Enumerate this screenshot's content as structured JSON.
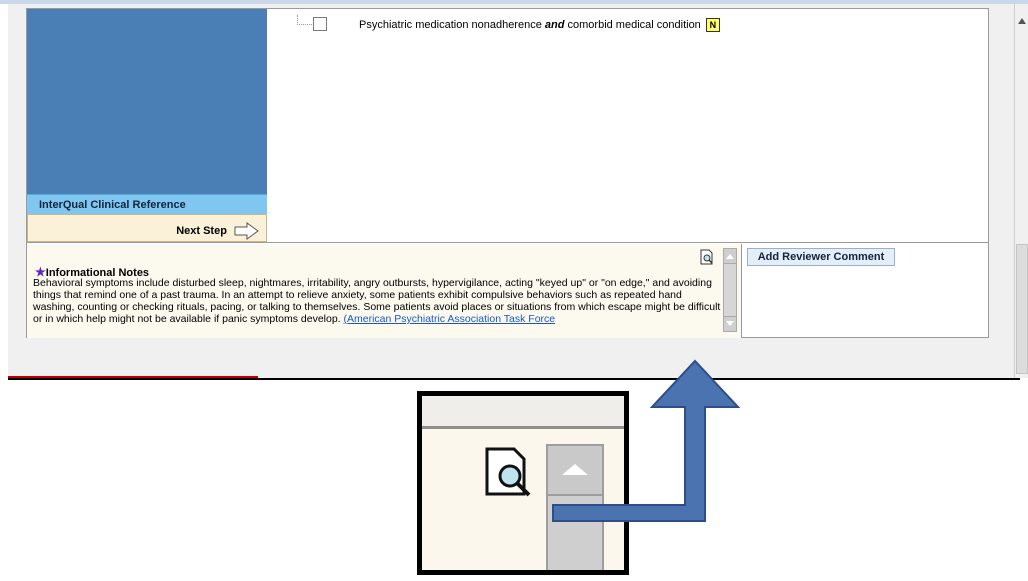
{
  "criteria": {
    "item_prefix": "Psychiatric medication nonadherence ",
    "item_emphasis": "and",
    "item_suffix": " comorbid medical condition",
    "note_badge": "N"
  },
  "left_panel": {
    "reference_label": "InterQual Clinical Reference",
    "next_step_label": "Next Step"
  },
  "notes": {
    "title": "Informational Notes",
    "body": "Behavioral symptoms include disturbed sleep, nightmares, irritability, angry outbursts, hypervigilance, acting \"keyed up\" or \"on edge,\" and avoiding things that remind one of a past trauma. In an attempt to relieve anxiety, some patients exhibit compulsive behaviors such as repeated hand washing, counting or checking rituals, pacing, or talking to themselves. Some patients avoid places or situations from which escape might be difficult or in which help might not be available if panic symptoms develop. ",
    "link_text": "(American Psychiatric Association Task Force"
  },
  "reviewer": {
    "button_label": "Add Reviewer Comment"
  },
  "colors": {
    "left_panel": "#4a7fb5",
    "reference_bar": "#7fc7f0",
    "next_step_bg": "#fbf0d8",
    "callout_arrow": "#4a73b0"
  },
  "icons": [
    "document-search-icon",
    "star-icon",
    "next-arrow-icon",
    "scroll-up-icon",
    "scroll-down-icon"
  ]
}
